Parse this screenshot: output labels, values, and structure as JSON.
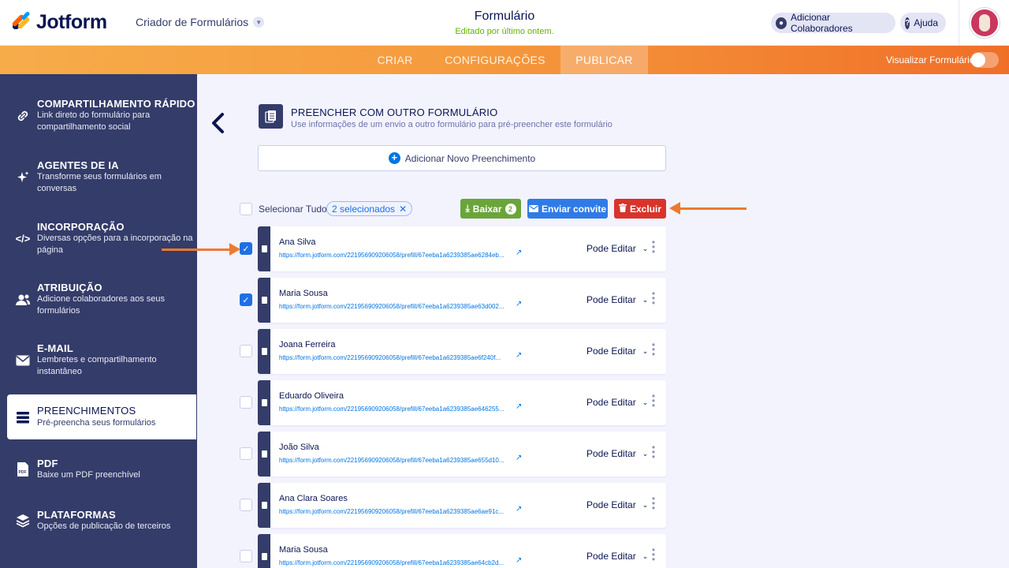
{
  "header": {
    "logo_text": "Jotform",
    "builder_menu": "Criador de Formulários",
    "form_title": "Formulário",
    "form_edited": "Editado por último ontem.",
    "add_collaborators": "Adicionar Colaboradores",
    "help": "Ajuda"
  },
  "nav": {
    "tabs": [
      "CRIAR",
      "CONFIGURAÇÕES",
      "PUBLICAR"
    ],
    "active_tab": "PUBLICAR",
    "preview_label": "Visualizar Formulário",
    "preview_toggle_on": false
  },
  "sidebar": {
    "items": [
      {
        "title": "COMPARTILHAMENTO RÁPIDO",
        "desc": "Link direto do formulário para compartilhamento social",
        "icon": "link-icon"
      },
      {
        "title": "AGENTES DE IA",
        "desc": "Transforme seus formulários em conversas",
        "icon": "sparkle-icon"
      },
      {
        "title": "INCORPORAÇÃO",
        "desc": "Diversas opções para a incorporação na página",
        "icon": "code-icon"
      },
      {
        "title": "ATRIBUIÇÃO",
        "desc": "Adicione colaboradores aos seus formulários",
        "icon": "users-icon"
      },
      {
        "title": "E-MAIL",
        "desc": "Lembretes e compartilhamento instantâneo",
        "icon": "mail-icon"
      },
      {
        "title": "PREENCHIMENTOS",
        "desc": "Pré-preencha seus formulários",
        "icon": "prefill-icon"
      },
      {
        "title": "PDF",
        "desc": "Baixe um PDF preenchível",
        "icon": "pdf-icon"
      },
      {
        "title": "PLATAFORMAS",
        "desc": "Opções de publicação de terceiros",
        "icon": "layers-icon"
      }
    ],
    "active_index": 5
  },
  "section": {
    "title": "PREENCHER COM OUTRO FORMULÁRIO",
    "desc": "Use informações de um envio a outro formulário para pré-preencher este formulário",
    "add_button": "Adicionar Novo Preenchimento"
  },
  "toolbar": {
    "select_all": "Selecionar Tudo",
    "selected_badge": "2 selecionados",
    "download": "Baixar",
    "download_count": "2",
    "send_invite": "Enviar convite",
    "delete": "Excluir"
  },
  "colors": {
    "navy": "#343c6a",
    "orange": "#f59b3e",
    "green": "#6aa53a",
    "blue": "#2f7be6",
    "red": "#d9342b"
  },
  "rows": [
    {
      "name": "Ana Silva",
      "link": "https://form.jotform.com/221956909206058/prefill/67eeba1a6239385ae6284eb...",
      "permission": "Pode Editar",
      "checked": true
    },
    {
      "name": "Maria Sousa",
      "link": "https://form.jotform.com/221956909206058/prefill/67eeba1a6239385ae63d002...",
      "permission": "Pode Editar",
      "checked": true
    },
    {
      "name": "Joana Ferreira",
      "link": "https://form.jotform.com/221956909206058/prefill/67eeba1a6239385ae6f240f...",
      "permission": "Pode Editar",
      "checked": false
    },
    {
      "name": "Eduardo Oliveira",
      "link": "https://form.jotform.com/221956909206058/prefill/67eeba1a6239385ae646255...",
      "permission": "Pode Editar",
      "checked": false
    },
    {
      "name": "João Silva",
      "link": "https://form.jotform.com/221956909206058/prefill/67eeba1a6239385ae655d10...",
      "permission": "Pode Editar",
      "checked": false
    },
    {
      "name": "Ana Clara Soares",
      "link": "https://form.jotform.com/221956909206058/prefill/67eeba1a6239385ae6ae91c...",
      "permission": "Pode Editar",
      "checked": false
    },
    {
      "name": "Maria Sousa",
      "link": "https://form.jotform.com/221956909206058/prefill/67eeba1a6239385ae64cb2d...",
      "permission": "Pode Editar",
      "checked": false
    }
  ]
}
